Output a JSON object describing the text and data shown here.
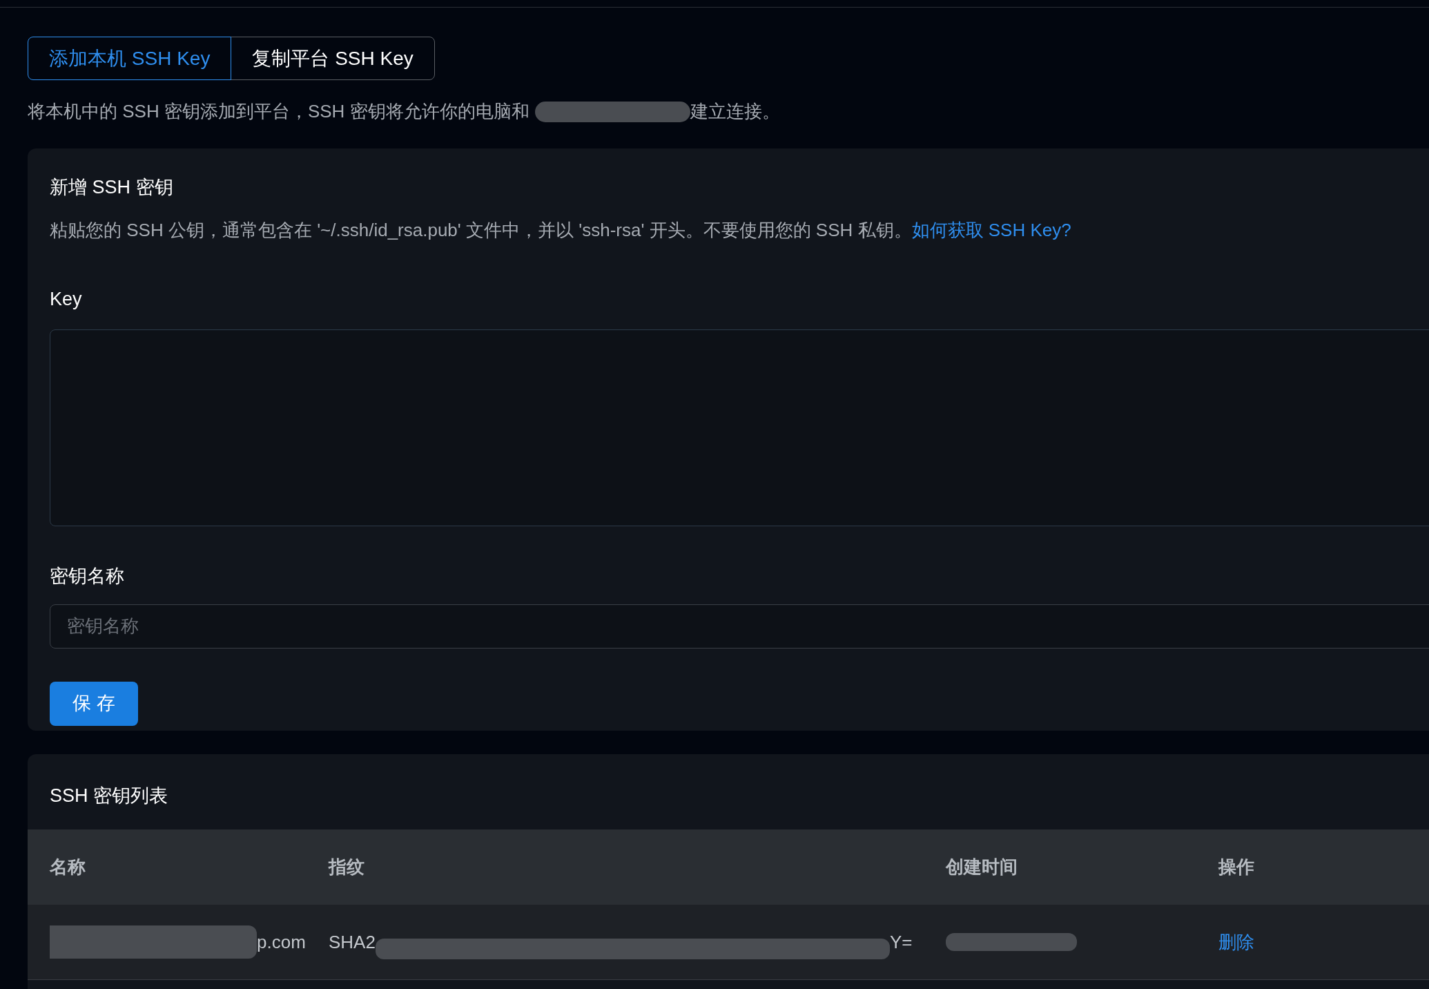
{
  "tabs": [
    {
      "label": "添加本机 SSH Key",
      "selected": true
    },
    {
      "label": "复制平台 SSH Key",
      "selected": false
    }
  ],
  "description": {
    "before": "将本机中的 SSH 密钥添加到平台，SSH 密钥将允许你的电脑和",
    "after": "建立连接。"
  },
  "add_card": {
    "title": "新增 SSH 密钥",
    "help": "粘贴您的 SSH 公钥，通常包含在 '~/.ssh/id_rsa.pub' 文件中，并以 'ssh-rsa' 开头。不要使用您的 SSH 私钥。",
    "help_link": "如何获取 SSH Key?",
    "key_label": "Key",
    "name_label": "密钥名称",
    "name_placeholder": "密钥名称",
    "save": "保 存"
  },
  "list_card": {
    "title": "SSH 密钥列表",
    "columns": [
      "名称",
      "指纹",
      "创建时间",
      "操作"
    ],
    "rows": [
      {
        "name": "p.com",
        "fingerprint_start": "SHA2",
        "fingerprint_end": "Y=",
        "action": "删除"
      }
    ]
  }
}
